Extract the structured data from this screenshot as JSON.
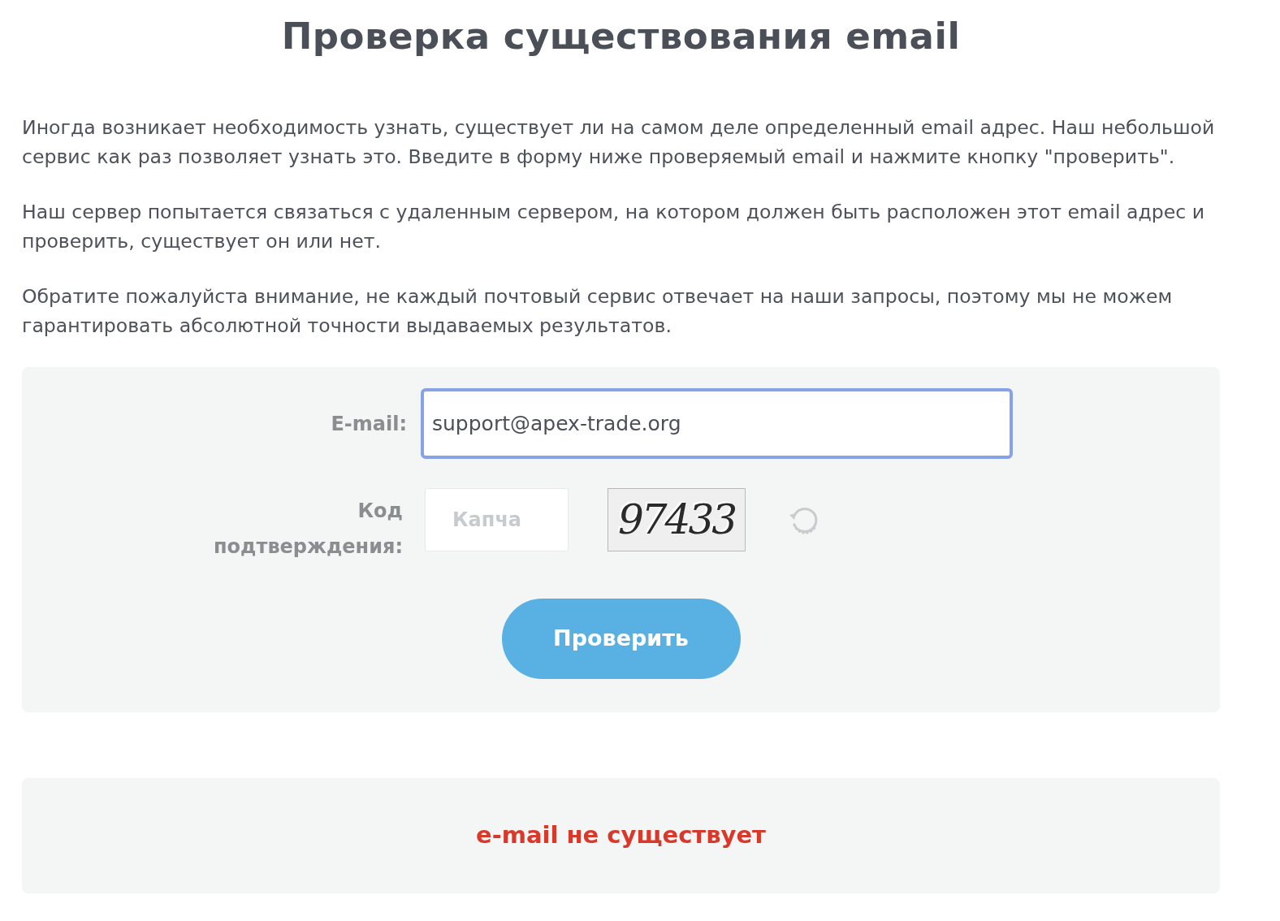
{
  "title": "Проверка существования email",
  "paragraphs": [
    "Иногда возникает необходимость узнать, существует ли на самом деле определенный email адрес. Наш небольшой сервис как раз позволяет узнать это. Введите в форму ниже проверяемый email и нажмите кнопку \"проверить\".",
    "Наш сервер попытается связаться с удаленным сервером, на котором должен быть расположен этот email адрес и проверить, существует он или нет.",
    "Обратите пожалуйста внимание, не каждый почтовый сервис отвечает на наши запросы, поэтому мы не можем гарантировать абсолютной точности выдаваемых результатов."
  ],
  "form": {
    "email": {
      "label": "E-mail:",
      "value": "support@apex-trade.org",
      "focused": true
    },
    "captcha": {
      "label": "Код подтверждения:",
      "placeholder": "Капча",
      "code": "97433"
    },
    "submit": "Проверить"
  },
  "result": {
    "text": "e-mail не существует",
    "kind": "error"
  }
}
